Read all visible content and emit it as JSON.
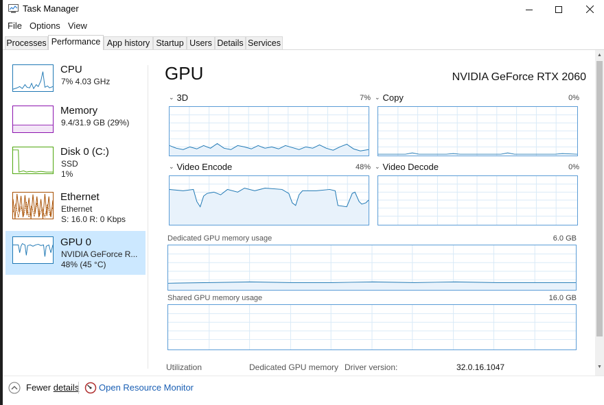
{
  "window": {
    "title": "Task Manager",
    "controls": {
      "minimize": "minimize-icon",
      "maximize": "maximize-icon",
      "close": "close-icon"
    }
  },
  "menu": [
    "File",
    "Options",
    "View"
  ],
  "tabs": [
    {
      "label": "Processes",
      "active": false
    },
    {
      "label": "Performance",
      "active": true
    },
    {
      "label": "App history",
      "active": false
    },
    {
      "label": "Startup",
      "active": false
    },
    {
      "label": "Users",
      "active": false
    },
    {
      "label": "Details",
      "active": false
    },
    {
      "label": "Services",
      "active": false
    }
  ],
  "sidebar": {
    "items": [
      {
        "title": "CPU",
        "line1": "7%  4.03 GHz",
        "line2": "",
        "color": "#1f78b4",
        "selected": false
      },
      {
        "title": "Memory",
        "line1": "9.4/31.9 GB (29%)",
        "line2": "",
        "color": "#8b12ae",
        "selected": false
      },
      {
        "title": "Disk 0 (C:)",
        "line1": "SSD",
        "line2": "1%",
        "color": "#4da60c",
        "selected": false
      },
      {
        "title": "Ethernet",
        "line1": "Ethernet",
        "line2": "S: 16.0  R: 0 Kbps",
        "color": "#a74f01",
        "selected": false
      },
      {
        "title": "GPU 0",
        "line1": "NVIDIA GeForce R...",
        "line2": "48%  (45 °C)",
        "color": "#1f78b4",
        "selected": true
      }
    ]
  },
  "main": {
    "title": "GPU",
    "gpu_name": "NVIDIA GeForce RTX 2060",
    "engines": [
      {
        "label": "3D",
        "value": "7%"
      },
      {
        "label": "Copy",
        "value": "0%"
      },
      {
        "label": "Video Encode",
        "value": "48%"
      },
      {
        "label": "Video Decode",
        "value": "0%"
      }
    ],
    "dedicated": {
      "label": "Dedicated GPU memory usage",
      "max": "6.0 GB"
    },
    "shared": {
      "label": "Shared GPU memory usage",
      "max": "16.0 GB"
    },
    "stats": {
      "utilization": "Utilization",
      "dedicated_memory": "Dedicated GPU memory",
      "driver_version_label": "Driver version:",
      "driver_version_value": "32.0.16.1047"
    }
  },
  "footer": {
    "fewer_details_prefix": "Fewer ",
    "fewer_details_underlined": "details",
    "open_resource_monitor": "Open Resource Monitor"
  },
  "colors": {
    "accent": "#1f78b4",
    "graph_border": "#5a9cd6",
    "selected_bg": "#cce8ff",
    "link": "#1a5fb4"
  }
}
